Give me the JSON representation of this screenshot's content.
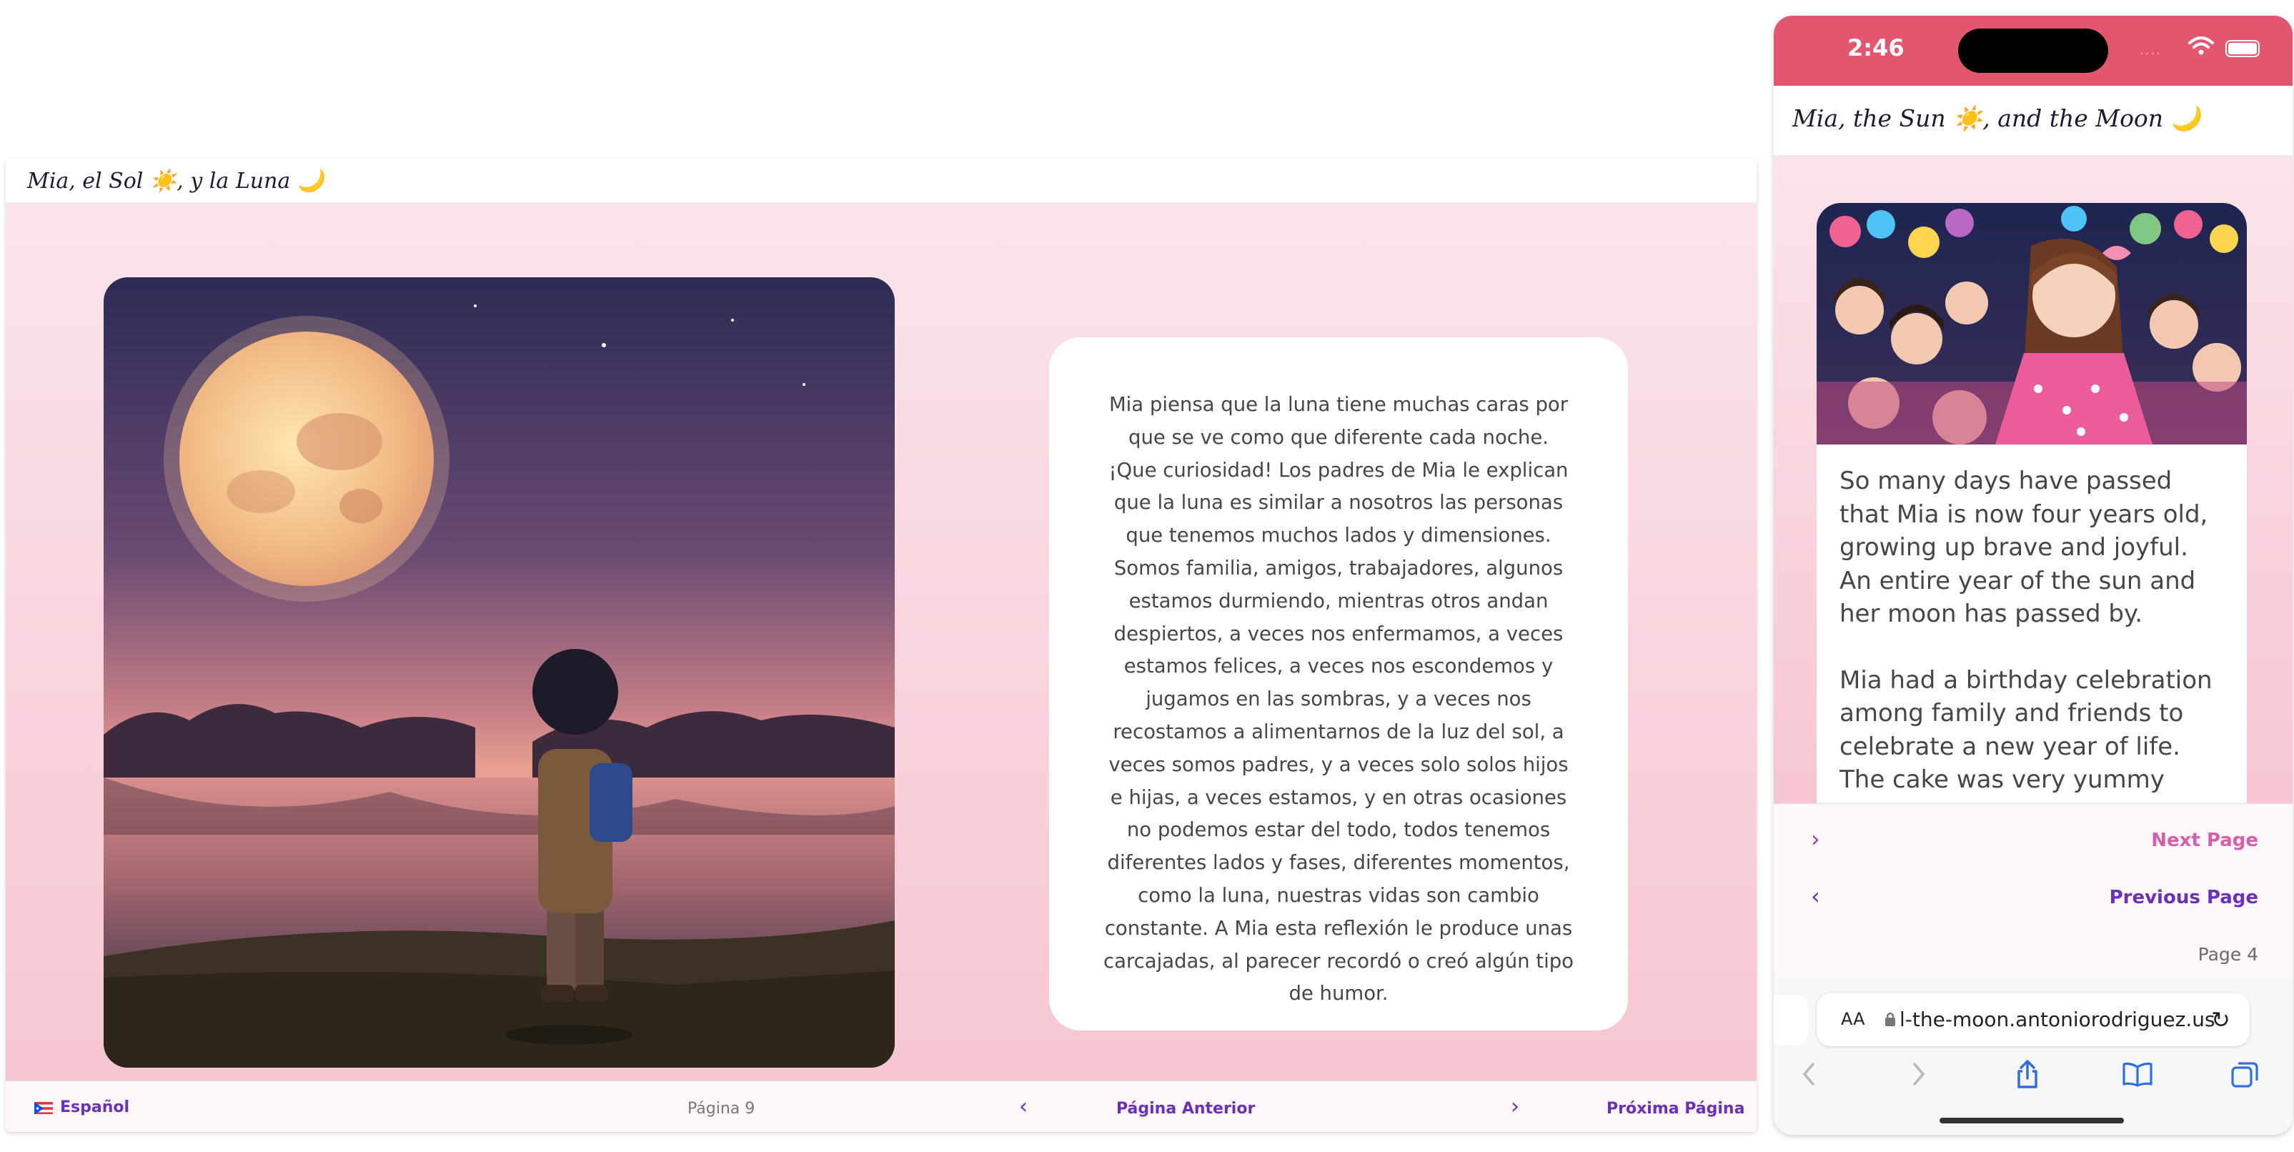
{
  "desktop": {
    "title": "Mia, el Sol ☀️, y la Luna 🌙",
    "image_alt": "Child with backpack looking at a full moon over a lake",
    "story_text": "Mia piensa que la luna tiene muchas caras por que se ve como que diferente cada noche. ¡Que curiosidad! Los padres de Mia le explican que la luna es similar a nosotros las personas que tenemos muchos lados y dimensiones. Somos familia, amigos, trabajadores, algunos estamos durmiendo, mientras otros andan despiertos, a veces nos enfermamos, a veces estamos felices, a veces nos escondemos y jugamos en las sombras, y a veces nos recostamos a alimentarnos de la luz del sol, a veces somos padres, y a veces solo solos hijos e hijas, a veces estamos, y en otras ocasiones no podemos estar del todo, todos tenemos diferentes lados y fases, diferentes momentos, como la luna, nuestras vidas son cambio constante. A Mia esta reflexión le produce unas carcajadas, al parecer recordó o creó algún tipo de humor.",
    "footer": {
      "language": "Español",
      "page": "Página 9",
      "prev": "Página Anterior",
      "next": "Próxima Página"
    }
  },
  "phone": {
    "status": {
      "time": "2:46",
      "signal": "...."
    },
    "title": "Mia, the Sun ☀️, and the Moon 🌙",
    "paragraphs": [
      "So many days have passed that Mia is now four years old, growing up brave and joyful. An entire year of the sun and her moon has passed by.",
      "Mia had a birthday celebration among family and friends to celebrate a new year of life. The cake was very yummy"
    ],
    "nav": {
      "next": "Next Page",
      "prev": "Previous Page",
      "page": "Page 4"
    },
    "browser": {
      "text_size": "AA",
      "url": "l-the-moon.antoniorodriguez.us"
    }
  },
  "colors": {
    "accent_purple": "#6b2fb8",
    "accent_pink": "#d55fa9",
    "status_bar": "#e2566e"
  }
}
